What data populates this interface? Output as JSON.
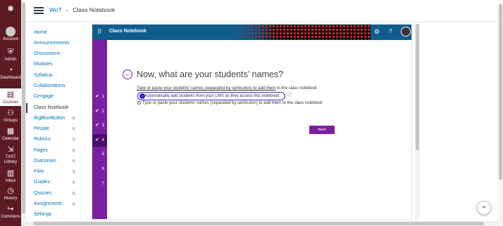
{
  "global_nav": {
    "items": [
      {
        "label": "",
        "icon": "canvas-logo-icon"
      },
      {
        "label": "Account",
        "icon": "avatar-icon"
      },
      {
        "label": "Admin",
        "icon": "shield-icon"
      },
      {
        "label": "Dashboard",
        "icon": "dashboard-icon"
      },
      {
        "label": "Courses",
        "icon": "book-icon"
      },
      {
        "label": "Groups",
        "icon": "groups-icon"
      },
      {
        "label": "Calendar",
        "icon": "calendar-icon"
      },
      {
        "label": "TXST Library",
        "icon": "library-icon"
      },
      {
        "label": "Inbox",
        "icon": "inbox-icon"
      },
      {
        "label": "History",
        "icon": "clock-icon"
      },
      {
        "label": "Commons",
        "icon": "commons-icon"
      }
    ]
  },
  "header": {
    "course_link": "WoT",
    "separator": "›",
    "current_page": "Class Notebook"
  },
  "course_nav": {
    "items": [
      {
        "label": "Home"
      },
      {
        "label": "Announcements"
      },
      {
        "label": "Discussions"
      },
      {
        "label": "Modules"
      },
      {
        "label": "Syllabus"
      },
      {
        "label": "Collaborations"
      },
      {
        "label": "Cengage"
      },
      {
        "label": "Class Notebook"
      },
      {
        "label": "BigBlueButton"
      },
      {
        "label": "People"
      },
      {
        "label": "Rubrics"
      },
      {
        "label": "Pages"
      },
      {
        "label": "Outcomes"
      },
      {
        "label": "Files"
      },
      {
        "label": "Grades"
      },
      {
        "label": "Quizzes"
      },
      {
        "label": "Assignments"
      },
      {
        "label": "Settings"
      }
    ]
  },
  "app": {
    "title": "Class Notebook",
    "steps": [
      "1",
      "2",
      "3",
      "4",
      "5",
      "6",
      "7"
    ],
    "question": "Now, what are your students' names?",
    "instruction_prefix": "Type or paste your students' names (separated by semicolon) to add them",
    "instruction_suffix": " to the class notebook",
    "option_auto": "Automatically add students from your LMS as they access this notebook",
    "option_manual": "Type or paste your students' names (separated by semicolon) to add them to the class notebook",
    "next_label": "Next"
  }
}
